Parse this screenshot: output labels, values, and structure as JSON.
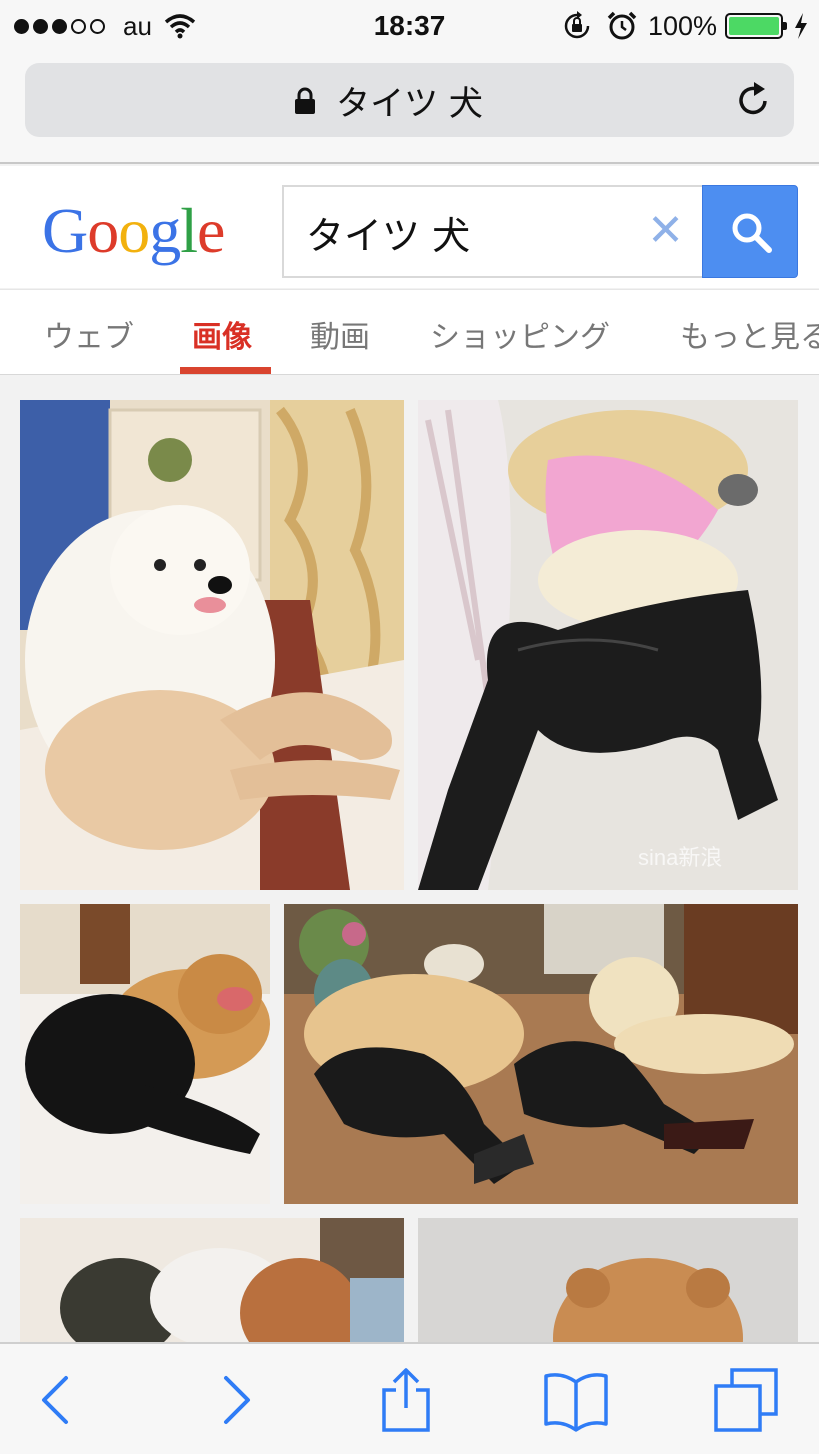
{
  "status_bar": {
    "carrier": "au",
    "time": "18:37",
    "battery_percent": "100%",
    "signal_bars_filled": 3,
    "signal_bars_total": 5
  },
  "browser": {
    "url_title": "タイツ 犬"
  },
  "search": {
    "query": "タイツ 犬"
  },
  "tabs": [
    {
      "label": "ウェブ",
      "active": false
    },
    {
      "label": "画像",
      "active": true
    },
    {
      "label": "動画",
      "active": false
    },
    {
      "label": "ショッピング",
      "active": false
    },
    {
      "label": "もっと見る",
      "active": false
    }
  ],
  "image_results": [
    {
      "watermark": ""
    },
    {
      "watermark": "sina新浪"
    },
    {
      "watermark": ""
    },
    {
      "watermark": ""
    },
    {
      "watermark": ""
    },
    {
      "watermark": ""
    }
  ],
  "colors": {
    "accent_tab": "#d93025",
    "search_button": "#4d8ef1",
    "battery": "#4cd964",
    "ios_blue": "#2f7cf6"
  },
  "icons": {
    "lock": "lock-icon",
    "reload": "reload-icon",
    "clear": "clear-icon",
    "search": "search-icon",
    "back": "back-icon",
    "forward": "forward-icon",
    "share": "share-icon",
    "bookmarks": "bookmarks-icon",
    "tabs": "tabs-icon"
  }
}
